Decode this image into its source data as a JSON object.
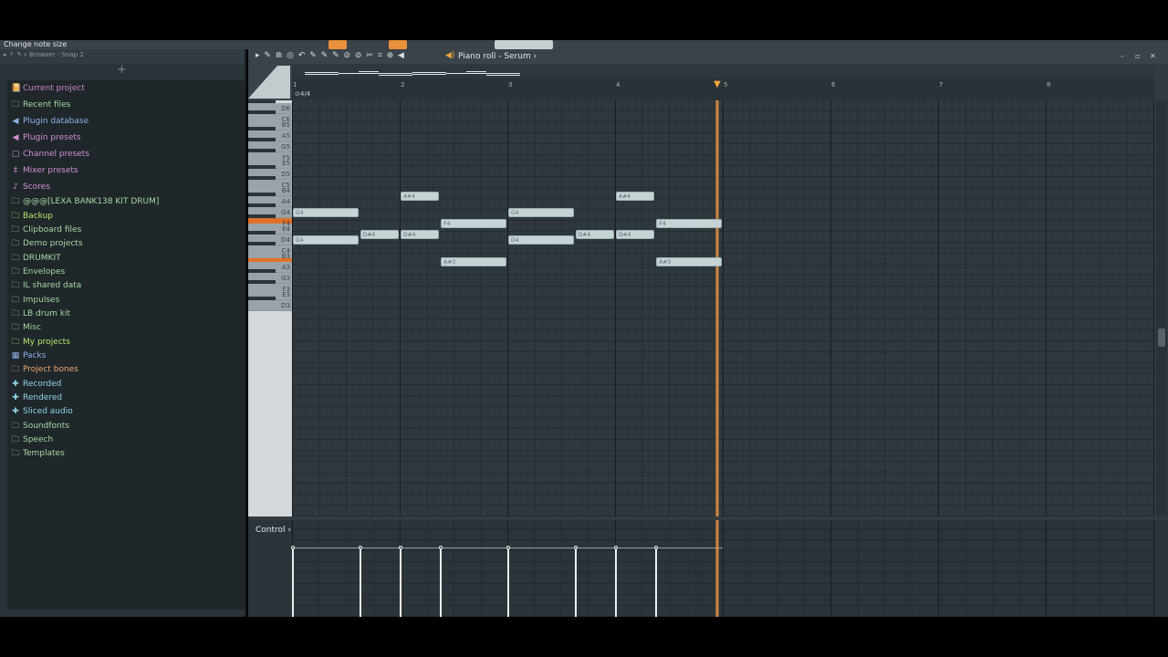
{
  "hint": "Change note size",
  "browser": {
    "path": "Browser - Snap 2",
    "add_label": "+",
    "items": [
      {
        "label": "Current project",
        "icon": "📔",
        "color": "#c987c9"
      },
      {
        "label": "Recent files",
        "icon": "🗀",
        "color": "#a8d8a0"
      },
      {
        "label": "Plugin database",
        "icon": "◀",
        "color": "#8fb2e8"
      },
      {
        "label": "Plugin presets",
        "icon": "◀",
        "color": "#d48fd4"
      },
      {
        "label": "Channel presets",
        "icon": "▢",
        "color": "#d48fd4"
      },
      {
        "label": "Mixer presets",
        "icon": "‡",
        "color": "#d48fd4"
      },
      {
        "label": "Scores",
        "icon": "♪",
        "color": "#d48fd4"
      },
      {
        "label": "@@@[LEXA BANK138 KIT DRUM]",
        "icon": "🗀",
        "color": "#a8d8a0"
      },
      {
        "label": "Backup",
        "icon": "🗀",
        "color": "#b8e86a"
      },
      {
        "label": "Clipboard files",
        "icon": "🗀",
        "color": "#a8d8a0"
      },
      {
        "label": "Demo projects",
        "icon": "🗀",
        "color": "#a8d8a0"
      },
      {
        "label": "DRUMKIT",
        "icon": "🗀",
        "color": "#a8d8a0"
      },
      {
        "label": "Envelopes",
        "icon": "🗀",
        "color": "#a8d8a0"
      },
      {
        "label": "IL shared data",
        "icon": "🗀",
        "color": "#a8d8a0"
      },
      {
        "label": "Impulses",
        "icon": "🗀",
        "color": "#a8d8a0"
      },
      {
        "label": "LB drum kit",
        "icon": "🗀",
        "color": "#a8d8a0"
      },
      {
        "label": "Misc",
        "icon": "🗀",
        "color": "#a8d8a0"
      },
      {
        "label": "My projects",
        "icon": "🗀",
        "color": "#b8e86a"
      },
      {
        "label": "Packs",
        "icon": "▦",
        "color": "#8fb2e8"
      },
      {
        "label": "Project bones",
        "icon": "🗀",
        "color": "#f0a870"
      },
      {
        "label": "Recorded",
        "icon": "✚",
        "color": "#8fd4e8"
      },
      {
        "label": "Rendered",
        "icon": "✚",
        "color": "#8fd4e8"
      },
      {
        "label": "Sliced audio",
        "icon": "✚",
        "color": "#8fd4e8"
      },
      {
        "label": "Soundfonts",
        "icon": "🗀",
        "color": "#a8d8a0"
      },
      {
        "label": "Speech",
        "icon": "🗀",
        "color": "#a8d8a0"
      },
      {
        "label": "Templates",
        "icon": "🗀",
        "color": "#a8d8a0"
      }
    ]
  },
  "piano_roll": {
    "title": "Piano roll - Serum",
    "title_arrow": "›",
    "tools": "▸ ✎ ⋒ ◎ ↶   ✎ ✎ ✎ ⊘ ⊘ ✂ ⌗ ⊕ ◀",
    "time_sig": "⊙4/4",
    "bars": [
      "1",
      "2",
      "3",
      "4",
      "5",
      "6",
      "7",
      "8"
    ],
    "playhead_beat": 15.8,
    "control_label": "Control",
    "control_arrow": "›",
    "accent": "#e0712a"
  },
  "keys": {
    "labels": [
      "D6",
      "C6",
      "B5",
      "A5",
      "G5",
      "F5",
      "E5",
      "D5",
      "C5",
      "B4",
      "A4",
      "G4",
      "F4",
      "E4",
      "D4",
      "C4",
      "B3",
      "A3",
      "G3",
      "F3",
      "E3",
      "D3"
    ],
    "active": [
      "F4",
      "A#3"
    ]
  },
  "notes": [
    {
      "label": "G4",
      "start": 0,
      "len": 2.5
    },
    {
      "label": "D4",
      "start": 0,
      "len": 2.5
    },
    {
      "label": "D#4",
      "start": 2.5,
      "len": 1.5
    },
    {
      "label": "A#4",
      "start": 4,
      "len": 1.5
    },
    {
      "label": "D#4",
      "start": 4,
      "len": 1.5
    },
    {
      "label": "F4",
      "start": 5.5,
      "len": 2.5
    },
    {
      "label": "A#3",
      "start": 5.5,
      "len": 2.5
    },
    {
      "label": "G4",
      "start": 8,
      "len": 2.5
    },
    {
      "label": "D4",
      "start": 8,
      "len": 2.5
    },
    {
      "label": "D#4",
      "start": 10.5,
      "len": 1.5
    },
    {
      "label": "A#4",
      "start": 12,
      "len": 1.5
    },
    {
      "label": "D#4",
      "start": 12,
      "len": 1.5
    },
    {
      "label": "F4",
      "start": 13.5,
      "len": 2.5
    },
    {
      "label": "A#3",
      "start": 13.5,
      "len": 2.5
    }
  ]
}
